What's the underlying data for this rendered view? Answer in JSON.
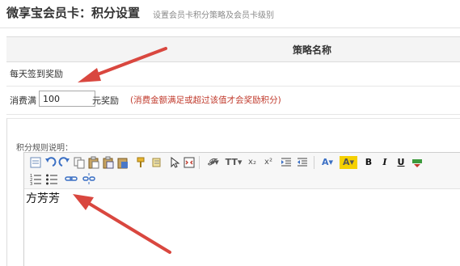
{
  "header": {
    "title": "微享宝会员卡：积分设置",
    "subtitle": "设置会员卡积分策略及会员卡级别"
  },
  "table": {
    "column_header": "策略名称"
  },
  "rows": {
    "signin_label": "每天签到奖励",
    "spend_prefix": "消费满",
    "spend_value": "100",
    "spend_suffix": "元奖励",
    "spend_hint": "(消费金额满足或超过该值才会奖励积分)"
  },
  "editor": {
    "label": "积分规则说明：",
    "content": "方芳芳",
    "toolbar_icons": [
      "source-icon",
      "undo-icon",
      "redo-icon",
      "copy-icon",
      "paste-icon",
      "paste-text-icon",
      "paste-word-icon",
      "format-brush-icon",
      "clear-format-icon",
      "select-icon",
      "fullscreen-icon",
      "font-family-icon",
      "font-size-icon",
      "subscript-icon",
      "superscript-icon",
      "indent-icon",
      "outdent-icon",
      "font-color-icon",
      "highlight-icon",
      "bold-icon",
      "italic-icon",
      "underline-icon",
      "strikethrough-icon",
      "ordered-list-icon",
      "unordered-list-icon",
      "link-icon",
      "unlink-icon"
    ]
  },
  "annotations": {
    "arrow_color": "#d9473f"
  }
}
